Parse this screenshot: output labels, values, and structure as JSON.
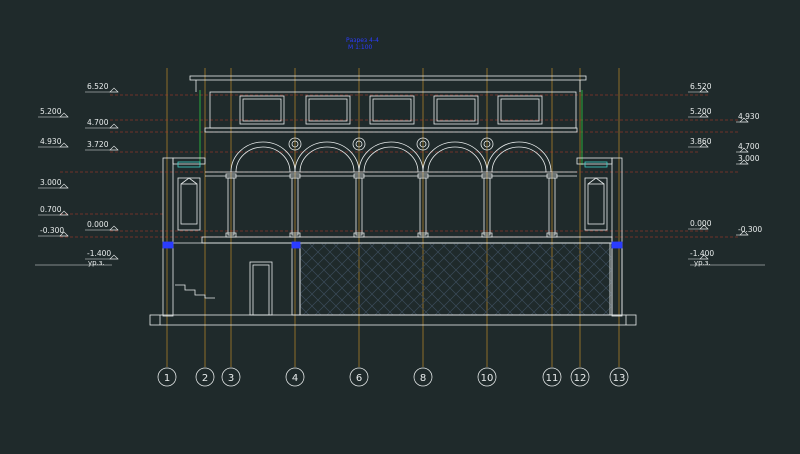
{
  "drawing": {
    "title": "Разрез 4-4",
    "scale": "М 1:100"
  },
  "colors": {
    "background": "#1f2a2b",
    "lines": "#e8ecec",
    "grid_axis": "#d99a2b",
    "level_line": "#c0392b",
    "title": "#2b3cff",
    "accent_green": "#2ecc40",
    "accent_blue": "#2b3cff",
    "accent_cyan": "#3ed2c8",
    "hatch": "#3a4a5a"
  },
  "left_levels": [
    {
      "value": "6.520"
    },
    {
      "value": "5.200"
    },
    {
      "value": "4.700"
    },
    {
      "value": "4.930"
    },
    {
      "value": "3.720"
    },
    {
      "value": "3.000"
    },
    {
      "value": "0.700"
    },
    {
      "value": "0.000"
    },
    {
      "value": "-0.300"
    },
    {
      "value": "-1.400"
    }
  ],
  "left_ground_label": "ур.з.",
  "right_levels": [
    {
      "value": "6.520"
    },
    {
      "value": "5.200"
    },
    {
      "value": "4.930"
    },
    {
      "value": "4.700"
    },
    {
      "value": "3.860"
    },
    {
      "value": "3.000"
    },
    {
      "value": "0.000"
    },
    {
      "value": "-0.300"
    },
    {
      "value": "-1.400"
    }
  ],
  "right_ground_label": "ур.з.",
  "grid_axes": [
    "1",
    "2",
    "3",
    "4",
    "6",
    "8",
    "10",
    "11",
    "12",
    "13"
  ]
}
